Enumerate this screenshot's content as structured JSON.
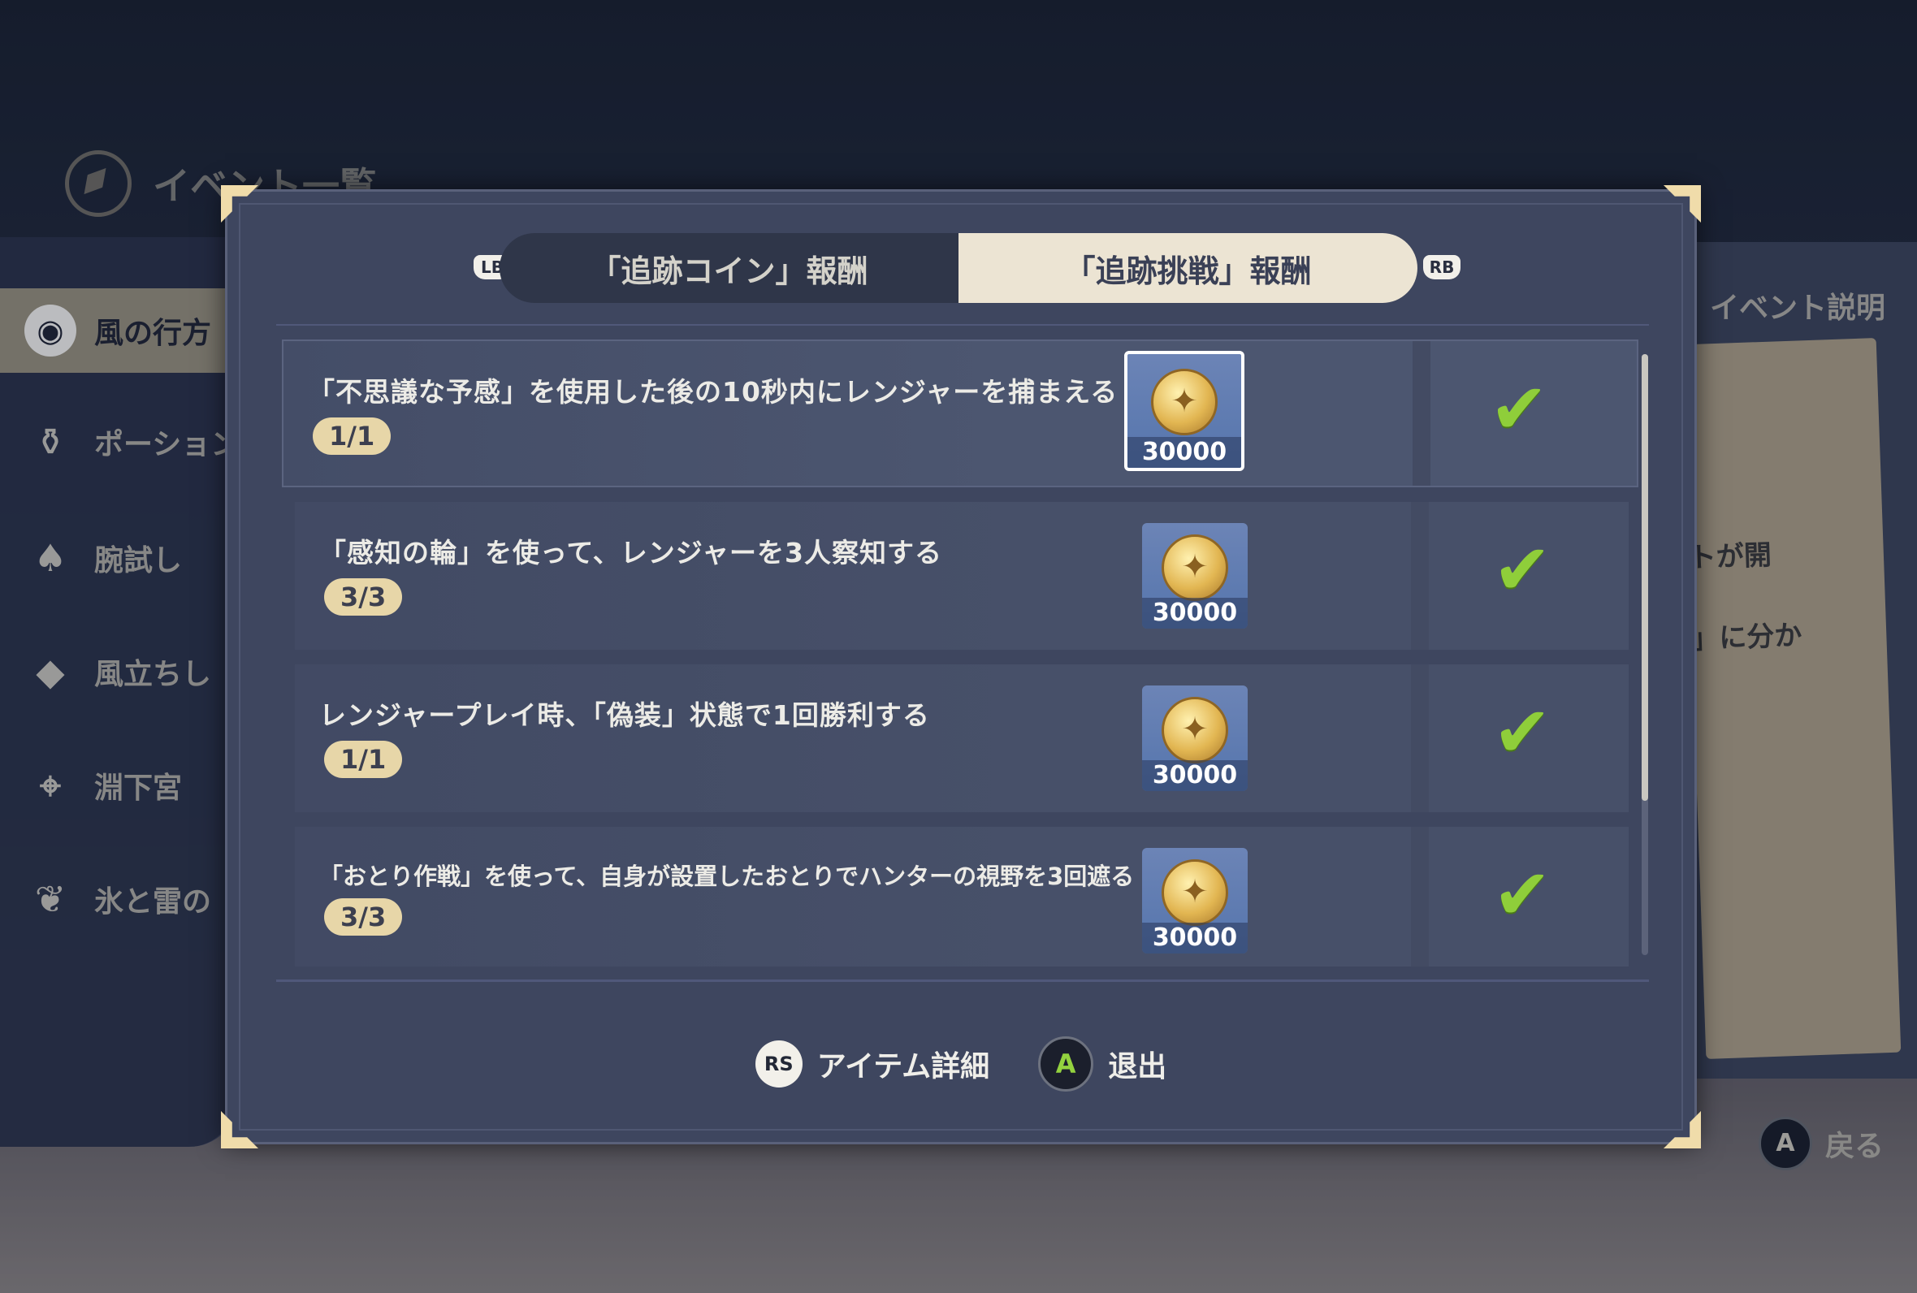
{
  "background": {
    "top_title": "イベント一覧",
    "left_menu": [
      {
        "label": "風の行方",
        "icon": "cat-mask-icon",
        "active": true
      },
      {
        "label": "ポーション",
        "icon": "potion-icon",
        "active": false
      },
      {
        "label": "腕試し",
        "icon": "cards-icon",
        "active": false
      },
      {
        "label": "風立ちし",
        "icon": "warning-diamond-icon",
        "active": false
      },
      {
        "label": "淵下宮",
        "icon": "map-pin-icon",
        "active": false
      },
      {
        "label": "氷と雷の",
        "icon": "leaf-icon",
        "active": false
      }
    ],
    "right_title": "イベント説明",
    "right_card_texts": [
      "トが開",
      "」に分か"
    ],
    "footer_back": "戻る",
    "footer_back_button": "A"
  },
  "modal": {
    "tabs": [
      {
        "label": "「追跡コイン」報酬",
        "active": false
      },
      {
        "label": "「追跡挑戦」報酬",
        "active": true
      }
    ],
    "lb": "LB",
    "rb": "RB",
    "rows": [
      {
        "task": "「不思議な予感」を使用した後の10秒内にレンジャーを捕まえる",
        "progress": "1/1",
        "reward": "30000",
        "completed": true,
        "selected": true
      },
      {
        "task": "「感知の輪」を使って、レンジャーを3人察知する",
        "progress": "3/3",
        "reward": "30000",
        "completed": true,
        "selected": false
      },
      {
        "task": "レンジャープレイ時、「偽装」状態で1回勝利する",
        "progress": "1/1",
        "reward": "30000",
        "completed": true,
        "selected": false
      },
      {
        "task": "「おとり作戦」を使って、自身が設置したおとりでハンターの視野を3回遮る",
        "progress": "3/3",
        "reward": "30000",
        "completed": true,
        "selected": false
      }
    ],
    "footer": {
      "rs_label": "RS",
      "item_detail": "アイテム詳細",
      "a_label": "A",
      "exit": "退出"
    }
  },
  "colors": {
    "accent_check": "#8fce3a",
    "tab_active_bg": "#ece4d3",
    "progress_pill": "#e7d6a8"
  }
}
